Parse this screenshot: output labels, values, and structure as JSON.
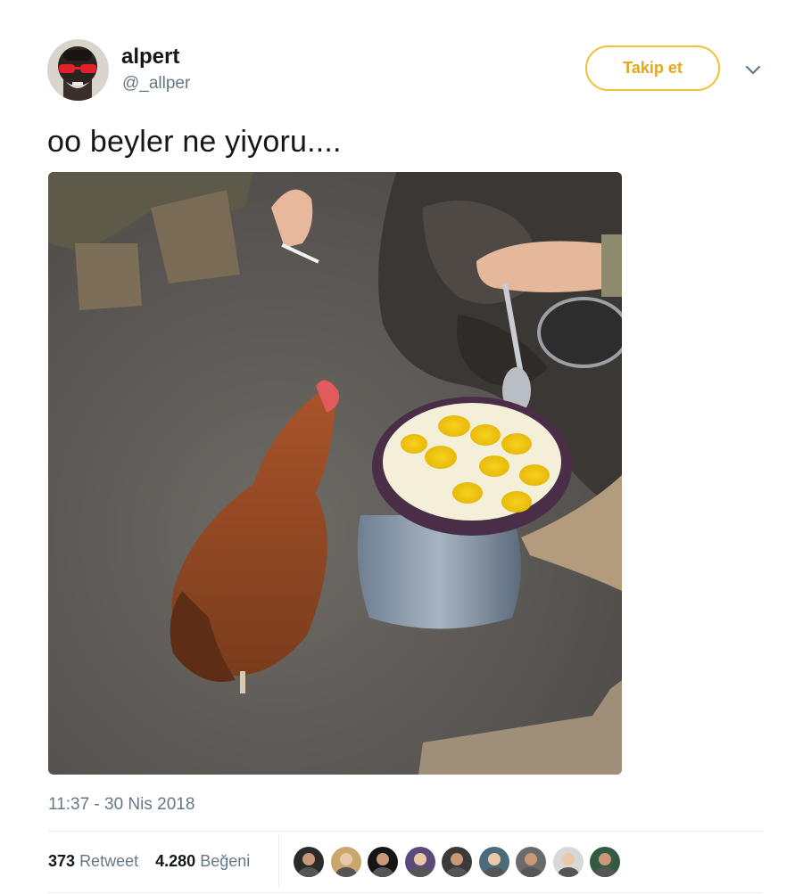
{
  "user": {
    "name": "alpert",
    "handle": "@_allper"
  },
  "actions": {
    "follow_label": "Takip et",
    "more_icon": "chevron-down-icon"
  },
  "tweet": {
    "text": "oo beyler ne yiyoru....",
    "timestamp": "11:37 - 30 Nis 2018"
  },
  "stats": {
    "retweet_count": "373",
    "retweet_label": "Retweet",
    "like_count": "4.280",
    "like_label": "Beğeni"
  },
  "colors": {
    "follow_accent": "#f1c232",
    "secondary_text": "#657786",
    "primary_text": "#14171a"
  },
  "likers": [
    {
      "icon": "avatar-1",
      "color": "#2b2b2b"
    },
    {
      "icon": "avatar-2",
      "color": "#c9a66b"
    },
    {
      "icon": "avatar-3",
      "color": "#151515"
    },
    {
      "icon": "avatar-4",
      "color": "#5a4a7a"
    },
    {
      "icon": "avatar-5",
      "color": "#3a3a3a"
    },
    {
      "icon": "avatar-6",
      "color": "#4c6a7a"
    },
    {
      "icon": "avatar-7",
      "color": "#6a6a6a"
    },
    {
      "icon": "avatar-8",
      "color": "#d8d8d8"
    },
    {
      "icon": "avatar-9",
      "color": "#355a44"
    }
  ]
}
